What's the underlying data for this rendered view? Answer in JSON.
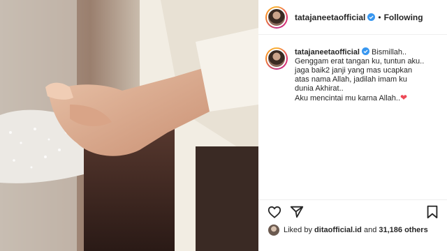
{
  "post": {
    "username": "tatajaneetaofficial",
    "separator": "•",
    "follow_status": "Following",
    "caption_lines": [
      "Bismillah..",
      "Genggam erat tangan ku, tuntun aku..",
      "jaga baik2 janji yang mas ucapkan",
      "atas nama Allah, jadilah imam ku",
      "dunia Akhirat..",
      "Aku mencintai mu karna Allah.."
    ],
    "caption_emoji": "❤",
    "likes_prefix": "Liked by",
    "liked_by_user": "ditaofficial.id",
    "likes_and": "and",
    "likes_count": "31,186 others"
  },
  "icons": {
    "like": "heart-outline-icon",
    "share": "paper-plane-icon",
    "save": "bookmark-icon",
    "verified": "verified-badge-icon"
  },
  "colors": {
    "verified": "#3897f0",
    "heart": "#ed4956",
    "text": "#262626"
  }
}
